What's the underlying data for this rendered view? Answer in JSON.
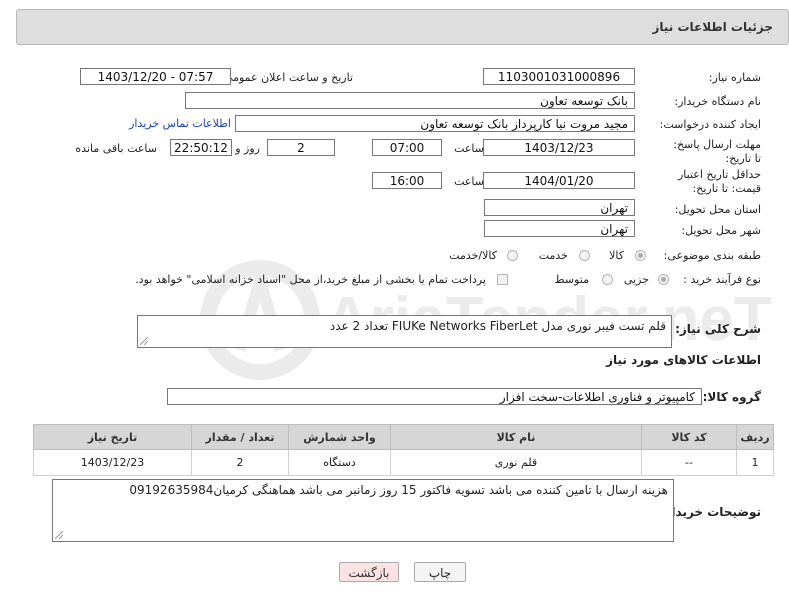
{
  "header": {
    "title": "جزئیات اطلاعات نیاز"
  },
  "form": {
    "need_number_label": "شماره نیاز:",
    "need_number": "1103001031000896",
    "announce_label": "تاریخ و ساعت اعلان عمومی:",
    "announce_value": "1403/12/20 - 07:57",
    "buyer_org_label": "نام دستگاه خریدار:",
    "buyer_org": "بانک توسعه تعاون",
    "creator_label": "ایجاد کننده درخواست:",
    "creator": "مجید مروت نیا کارپرداز بانک توسعه تعاون",
    "contact_link": "اطلاعات تماس خریدار",
    "deadline_label": "مهلت ارسال پاسخ: تا تاریخ:",
    "deadline_date": "1403/12/23",
    "time_word": "ساعت",
    "deadline_time": "07:00",
    "days_value": "2",
    "days_word": "روز و",
    "remaining_time": "22:50:12",
    "remaining_word": "ساعت باقی مانده",
    "validity_label": "حداقل تاریخ اعتبار قیمت: تا تاریخ:",
    "validity_date": "1404/01/20",
    "validity_time": "16:00",
    "province_label": "استان محل تحویل:",
    "province": "تهران",
    "city_label": "شهر محل تحویل:",
    "city": "تهران",
    "category_label": "طبقه بندی موضوعی:",
    "category_options": [
      "کالا",
      "خدمت",
      "کالا/خدمت"
    ],
    "process_label": "نوع فرآیند خرید :",
    "process_options": [
      "جزیی",
      "متوسط"
    ],
    "payment_note": "پرداخت تمام یا بخشی از مبلغ خرید،از محل \"اسناد خزانه اسلامی\" خواهد بود."
  },
  "description": {
    "label": "شرح کلی نیاز:",
    "value": "قلم تست فیبر نوری مدل FIUKe Networks FiberLet تعداد 2 عدد"
  },
  "goods_info": {
    "title": "اطلاعات کالاهای مورد نیاز",
    "group_label": "گروه کالا:",
    "group_value": "کامپیوتر و فناوری اطلاعات-سخت افزار"
  },
  "table": {
    "headers": [
      "ردیف",
      "کد کالا",
      "نام کالا",
      "واحد شمارش",
      "تعداد / مقدار",
      "تاریخ نیاز"
    ],
    "rows": [
      [
        "1",
        "--",
        "قلم نوری",
        "دستگاه",
        "2",
        "1403/12/23"
      ]
    ]
  },
  "buyer_notes": {
    "label": "توضیحات خریدار:",
    "value": "هزینه ارسال با تامین کننده می باشد تسویه فاکتور 15 روز زمانبر می باشد هماهنگی کرمیان09192635984"
  },
  "buttons": {
    "print": "چاپ",
    "back": "بازگشت"
  },
  "watermark": "AriaTender.neT"
}
